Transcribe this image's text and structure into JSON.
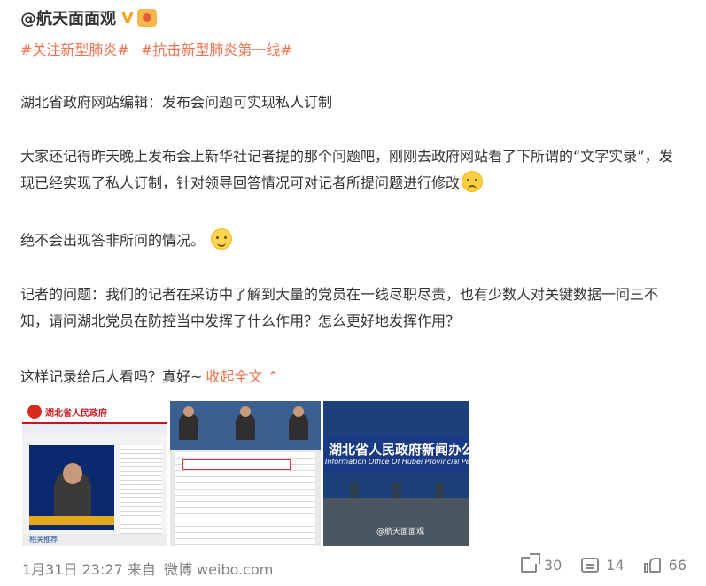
{
  "post": {
    "author": "@航天面面观",
    "verified_badge": "V",
    "topics": [
      "#关注新型肺炎#",
      "#抗击新型肺炎第一线#"
    ],
    "paragraphs": [
      "湖北省政府网站编辑：发布会问题可实现私人订制",
      "大家还记得昨天晚上发布会上新华社记者提的那个问题吧，刚刚去政府网站看了下所谓的“文字实录”，发现已经实现了私人订制，针对领导回答情况可对记者所提问题进行修改",
      "绝不会出现答非所问的情况。",
      "记者的问题：我们的记者在采访中了解到大量的党员在一线尽职尽责，也有少数人对关键数据一问三不知，请问湖北党员在防控当中发挥了什么作用？怎么更好地发挥作用？",
      "这样记录给后人看吗？真好~"
    ],
    "collapse_label": "收起全文 ⌃"
  },
  "images": {
    "img1_title": "湖北省人民政府",
    "img1_footer": "相关推荐",
    "img3_cn": "湖北省人民政府新闻办公室",
    "img3_en": "Information Office Of Hubei Provincial People's Governme",
    "img3_watermark": "@航天面面观"
  },
  "footer": {
    "time": "1月31日 23:27",
    "source_prefix": "来自",
    "source": "微博 weibo.com"
  },
  "actions": {
    "forward_count": "30",
    "comment_count": "14",
    "like_count": "66"
  },
  "colors": {
    "accent": "#eb7350",
    "text": "#333333",
    "muted": "#808080"
  },
  "icons": [
    "verified-badge-icon",
    "medal-icon",
    "sweat-smile-emoji",
    "smile-emoji",
    "forward-icon",
    "comment-icon",
    "like-icon"
  ]
}
